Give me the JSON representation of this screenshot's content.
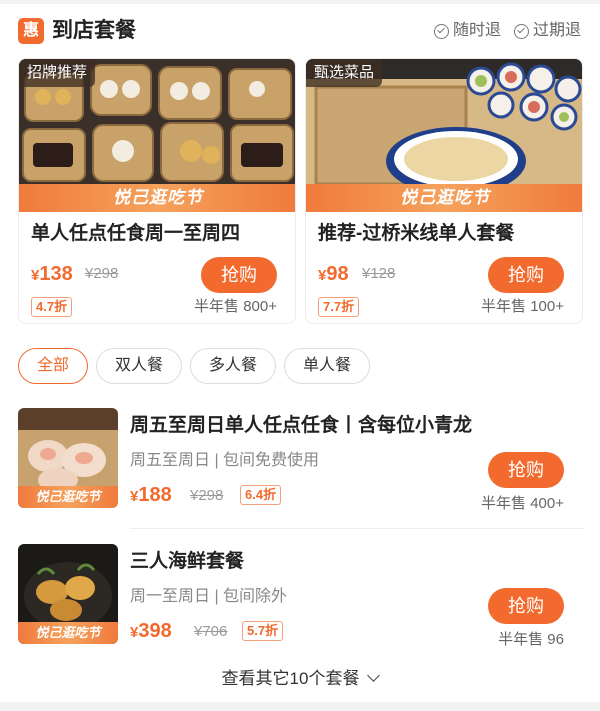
{
  "header": {
    "badge": "惠",
    "title": "到店套餐",
    "guarantee_1": "随时退",
    "guarantee_2": "过期退"
  },
  "deals": [
    {
      "tag": "招牌推荐",
      "banner": "悦己逛吃节",
      "title": "单人任点任食周一至周四",
      "currency": "¥",
      "price": "138",
      "original_price": "¥298",
      "discount": "4.7折",
      "buy_label": "抢购",
      "sales": "半年售 800+"
    },
    {
      "tag": "甄选菜品",
      "banner": "悦己逛吃节",
      "title": "推荐-过桥米线单人套餐",
      "currency": "¥",
      "price": "98",
      "original_price": "¥128",
      "discount": "7.7折",
      "buy_label": "抢购",
      "sales": "半年售 100+"
    }
  ],
  "filters": [
    "全部",
    "双人餐",
    "多人餐",
    "单人餐"
  ],
  "active_filter": "全部",
  "list": [
    {
      "banner": "悦己逛吃节",
      "title": "周五至周日单人任点任食丨含每位小青龙",
      "subtitle": "周五至周日 | 包间免费使用",
      "currency": "¥",
      "price": "188",
      "original_price": "¥298",
      "discount": "6.4折",
      "buy_label": "抢购",
      "sales": "半年售 400+"
    },
    {
      "banner": "悦己逛吃节",
      "title": "三人海鲜套餐",
      "subtitle": "周一至周日 | 包间除外",
      "currency": "¥",
      "price": "398",
      "original_price": "¥706",
      "discount": "5.7折",
      "buy_label": "抢购",
      "sales": "半年售 96"
    }
  ],
  "more_label": "查看其它10个套餐",
  "colors": {
    "accent": "#f26a2e",
    "banner": "#f5a25c",
    "muted": "#999999"
  },
  "icons": [
    "check-circle-icon",
    "chevron-down-icon"
  ]
}
